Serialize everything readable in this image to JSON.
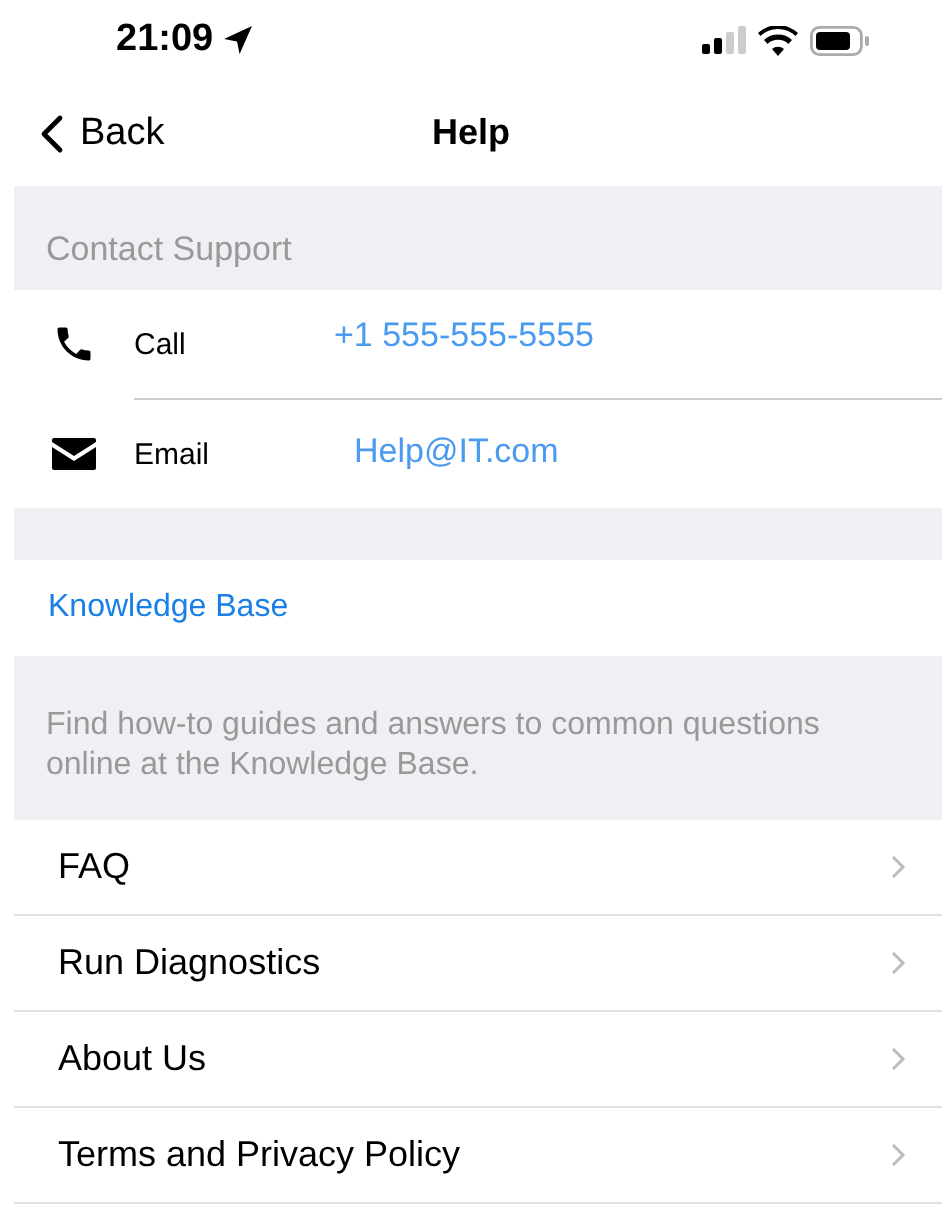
{
  "status_bar": {
    "time": "21:09"
  },
  "nav": {
    "back": "Back",
    "title": "Help"
  },
  "contact": {
    "header": "Contact Support",
    "rows": [
      {
        "kind": "phone",
        "label": "Call",
        "value": "+1 555-555-5555"
      },
      {
        "kind": "email",
        "label": "Email",
        "value": "Help@IT.com"
      }
    ]
  },
  "knowledge_base": {
    "link": "Knowledge Base",
    "description": "Find how-to guides and answers to common questions online at the Knowledge Base."
  },
  "menu": [
    {
      "label": "FAQ"
    },
    {
      "label": "Run Diagnostics"
    },
    {
      "label": "About Us"
    },
    {
      "label": "Terms and Privacy Policy"
    }
  ]
}
